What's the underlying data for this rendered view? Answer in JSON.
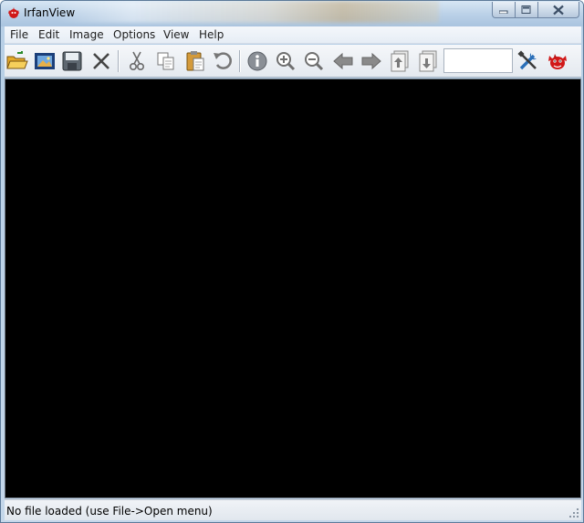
{
  "window": {
    "title": "IrfanView"
  },
  "menu": {
    "items": [
      "File",
      "Edit",
      "Image",
      "Options",
      "View",
      "Help"
    ]
  },
  "toolbar": {
    "buttons": [
      {
        "icon": "open-folder-icon",
        "label": "Open"
      },
      {
        "icon": "slideshow-icon",
        "label": "Slideshow"
      },
      {
        "icon": "save-icon",
        "label": "Save"
      },
      {
        "icon": "delete-icon",
        "label": "Delete"
      },
      {
        "icon": "cut-icon",
        "label": "Cut"
      },
      {
        "icon": "copy-icon",
        "label": "Copy"
      },
      {
        "icon": "paste-icon",
        "label": "Paste"
      },
      {
        "icon": "undo-icon",
        "label": "Undo"
      },
      {
        "icon": "info-icon",
        "label": "Information"
      },
      {
        "icon": "zoom-in-icon",
        "label": "Zoom in"
      },
      {
        "icon": "zoom-out-icon",
        "label": "Zoom out"
      },
      {
        "icon": "previous-icon",
        "label": "Previous file"
      },
      {
        "icon": "next-icon",
        "label": "Next file"
      },
      {
        "icon": "first-page-icon",
        "label": "Previous page"
      },
      {
        "icon": "next-page-icon",
        "label": "Next page"
      },
      {
        "icon": "settings-tools-icon",
        "label": "Properties"
      },
      {
        "icon": "irfanview-devil-icon",
        "label": "About"
      }
    ],
    "zoom_value": ""
  },
  "status": {
    "text": "No file loaded (use File->Open menu)"
  },
  "colors": {
    "viewer_bg": "#000000",
    "titlebar": "#bcd2e8",
    "accent_red": "#d01818"
  }
}
